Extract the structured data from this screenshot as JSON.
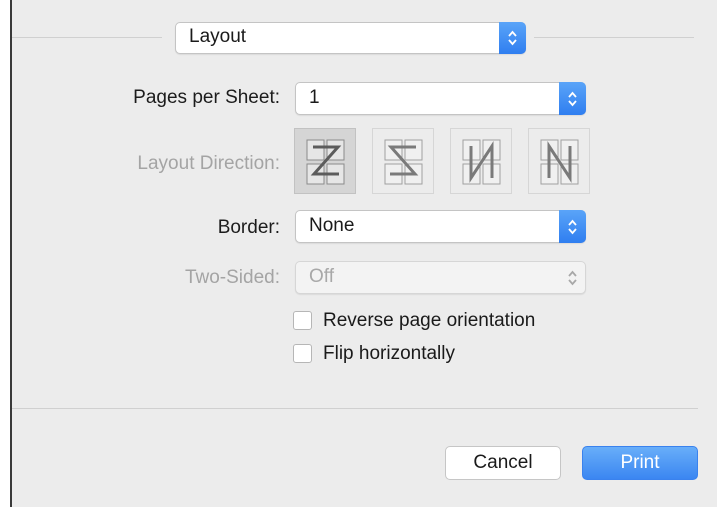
{
  "preset_menu": {
    "value": "Layout"
  },
  "pages_per_sheet": {
    "label": "Pages per Sheet:",
    "value": "1"
  },
  "layout_direction": {
    "label": "Layout Direction:",
    "options": [
      "z-order",
      "reverse-z-order",
      "n-order",
      "reverse-n-order"
    ]
  },
  "border": {
    "label": "Border:",
    "value": "None"
  },
  "two_sided": {
    "label": "Two-Sided:",
    "value": "Off"
  },
  "options": {
    "reverse_page_orientation": "Reverse page orientation",
    "flip_horizontally": "Flip horizontally"
  },
  "buttons": {
    "cancel": "Cancel",
    "print": "Print"
  },
  "colors": {
    "accent": "#3b86f1",
    "dialog_bg": "#ececec"
  }
}
